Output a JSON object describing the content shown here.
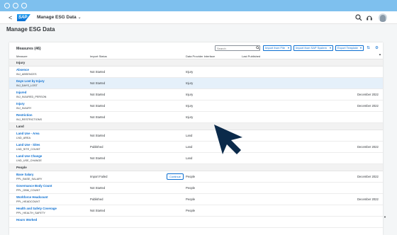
{
  "app": {
    "title": "Manage ESG Data",
    "logo_text": "SAP",
    "back_symbol": "<",
    "title_chevron": "⌄",
    "icons": [
      "search-icon",
      "help-icon",
      "notifications-icon",
      "user-avatar"
    ]
  },
  "page": {
    "title": "Manage ESG Data"
  },
  "toolbar": {
    "title": "Measures (46)",
    "search_placeholder": "Search",
    "import_file": "Import from File",
    "import_sap": "Import from SAP System",
    "export_template": "Export Template",
    "sort_icon": "⇅",
    "settings_icon": "⚙"
  },
  "columns": {
    "measure": "Measure",
    "import_status": "Import Status",
    "data_provider": "Data Provider Interface",
    "last_published": "Last Published"
  },
  "groups": [
    {
      "name": "Injury",
      "rows": [
        {
          "name": "Absence",
          "code": "INJ_ABSENCES",
          "status": "Not Started",
          "iface": "Injury",
          "published": "",
          "selected": false,
          "action": ""
        },
        {
          "name": "Days Lost by Injury",
          "code": "INJ_DAYS_LOST",
          "status": "Not Started",
          "iface": "Injury",
          "published": "",
          "selected": true,
          "action": ""
        },
        {
          "name": "Injured",
          "code": "INJ_INJURED_PERSON",
          "status": "Not Started",
          "iface": "Injury",
          "published": "December 2022",
          "selected": false,
          "action": ""
        },
        {
          "name": "Injury",
          "code": "INJ_INJURY",
          "status": "Not Started",
          "iface": "Injury",
          "published": "December 2022",
          "selected": false,
          "action": ""
        },
        {
          "name": "Restriction",
          "code": "INJ_RESTRICTIONS",
          "status": "Not Started",
          "iface": "Injury",
          "published": "",
          "selected": false,
          "action": ""
        }
      ]
    },
    {
      "name": "Land",
      "rows": [
        {
          "name": "Land Use - Area",
          "code": "LND_AREA",
          "status": "Not Started",
          "iface": "Land",
          "published": "",
          "selected": false,
          "action": ""
        },
        {
          "name": "Land Use - Sites",
          "code": "LND_SITE_COUNT",
          "status": "Published",
          "iface": "Land",
          "published": "December 2022",
          "selected": false,
          "action": ""
        },
        {
          "name": "Land Use Change",
          "code": "LND_USE_CHANGE",
          "status": "Not Started",
          "iface": "Land",
          "published": "",
          "selected": false,
          "action": ""
        }
      ]
    },
    {
      "name": "People",
      "rows": [
        {
          "name": "Base Salary",
          "code": "PPL_BASE_SALARY",
          "status": "Import Failed",
          "iface": "People",
          "published": "December 2022",
          "selected": false,
          "action": "Continue"
        },
        {
          "name": "Governance Body Count",
          "code": "PPL_GBM_COUNT",
          "status": "Not Started",
          "iface": "People",
          "published": "",
          "selected": false,
          "action": ""
        },
        {
          "name": "Workforce Headcount",
          "code": "PPL_HEADCOUNT",
          "status": "Published",
          "iface": "People",
          "published": "December 2022",
          "selected": false,
          "action": ""
        },
        {
          "name": "Health and Safety Coverage",
          "code": "PPL_HEALTH_SAFETY",
          "status": "Not Started",
          "iface": "People",
          "published": "",
          "selected": false,
          "action": ""
        },
        {
          "name": "Hours Worked",
          "code": "",
          "status": "",
          "iface": "",
          "published": "",
          "selected": false,
          "action": ""
        }
      ]
    }
  ],
  "scroll": {
    "up": "▲",
    "down": "▼"
  },
  "colors": {
    "accent": "#0a6ed1",
    "window_bar": "#7ec0ee",
    "selected_row": "#e5f0fa",
    "cursor": "#0b2a4a"
  }
}
